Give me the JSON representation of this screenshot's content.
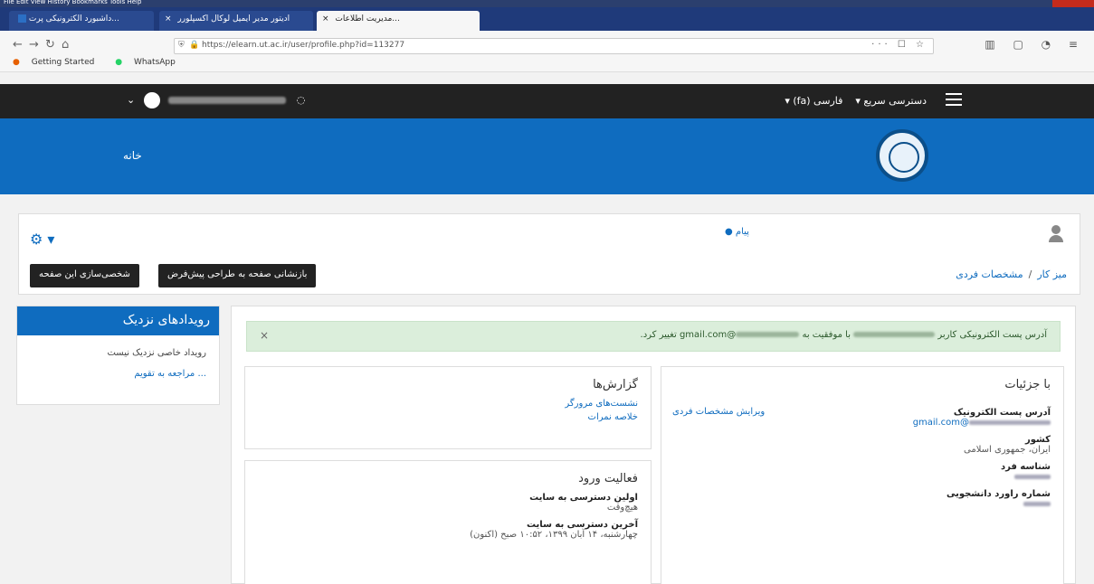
{
  "browser": {
    "tabs": [
      {
        "label": "داشبورد الکترونیکی پرت..."
      },
      {
        "label": "ادیتور مدیر ایمیل لوکال اکسپلورر"
      },
      {
        "label": "مدیریت اطلاعات..."
      }
    ],
    "url": "https://elearn.ut.ac.ir/user/profile.php?id=113277",
    "url_end_icons": "··· ☐ ☆",
    "bookmarks": [
      "Getting Started",
      "WhatsApp"
    ]
  },
  "topbar": {
    "quick_access": "دسترسی سریع",
    "language": "فارسی (fa)"
  },
  "banner": {
    "home": "خانه"
  },
  "pagehead": {
    "message": "پیام",
    "reset_button": "بازنشانی صفحه به طراحی پیش‌فرض",
    "customize_button": "شخصی‌سازی این صفحه",
    "breadcrumb": {
      "dashboard": "میز کار",
      "separator": "/",
      "profile": "مشخصات فردی"
    }
  },
  "events": {
    "title": "رویدادهای نزدیک",
    "none": "رویداد خاصی نزدیک نیست",
    "calendar_link": "... مراجعه به تقویم"
  },
  "alert": {
    "prefix": "آدرس پست الکترونیکی کاربر",
    "middle": "با موفقیت به",
    "email": "@gmail.com",
    "suffix": "تغییر کرد.",
    "close": "×"
  },
  "details": {
    "title": "با جزئیات",
    "edit_profile": "ویرایش مشخصات فردی",
    "email_label": "آدرس پست الکترونیک",
    "email_value": "@gmail.com",
    "country_label": "کشور",
    "country_value": "ایران، جمهوری اسلامی",
    "id_label": "شناسه فرد",
    "student_label": "شماره راورد دانشجویی"
  },
  "reports": {
    "title": "گزارش‌ها",
    "browser_sessions": "نشست‌های مرورگر",
    "grades_overview": "خلاصه نمرات"
  },
  "login_activity": {
    "title": "فعالیت ورود",
    "first_access_label": "اولین دسترسی به سایت",
    "first_access_value": "هیچ‌وقت",
    "last_access_label": "آخرین دسترسی به سایت",
    "last_access_value": "چهارشنبه، ۱۴ آبان ۱۳۹۹، ۱۰:۵۲ صبح (اکنون)"
  }
}
